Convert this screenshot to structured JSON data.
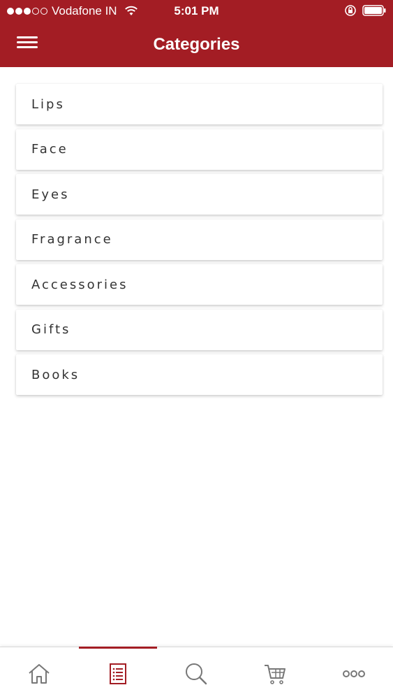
{
  "status_bar": {
    "carrier": "Vodafone IN",
    "time": "5:01 PM",
    "signal_bars_filled": 3,
    "signal_bars_total": 5
  },
  "header": {
    "title": "Categories",
    "background_color": "#a31d24",
    "menu_icon": "hamburger-icon"
  },
  "categories": [
    {
      "label": "Lips"
    },
    {
      "label": "Face"
    },
    {
      "label": "Eyes"
    },
    {
      "label": "Fragrance"
    },
    {
      "label": "Accessories"
    },
    {
      "label": "Gifts"
    },
    {
      "label": "Books"
    }
  ],
  "tab_bar": {
    "active_tab": "categories",
    "accent_color": "#a31d24",
    "tabs": [
      {
        "id": "home",
        "icon": "home-icon"
      },
      {
        "id": "categories",
        "icon": "list-icon"
      },
      {
        "id": "search",
        "icon": "search-icon"
      },
      {
        "id": "cart",
        "icon": "cart-icon"
      },
      {
        "id": "more",
        "icon": "more-icon"
      }
    ]
  }
}
